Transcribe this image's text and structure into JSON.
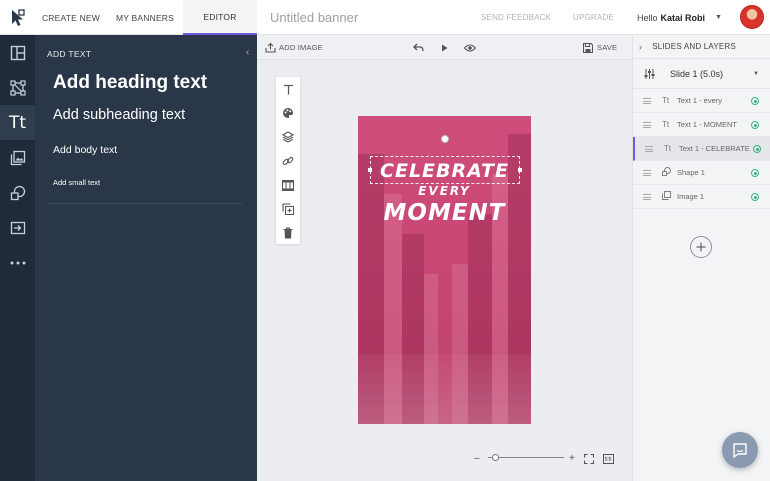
{
  "nav": {
    "tabs": [
      {
        "label": "CREATE NEW"
      },
      {
        "label": "MY BANNERS"
      },
      {
        "label": "EDITOR"
      }
    ],
    "banner_title": "Untitled banner",
    "send_feedback": "SEND FEEDBACK",
    "upgrade": "UPGRADE",
    "hello": "Hello",
    "user_name": "Katai Robi"
  },
  "left_panel": {
    "title": "ADD TEXT",
    "heading": "Add heading text",
    "subheading": "Add subheading text",
    "body": "Add body text",
    "small": "Add small text"
  },
  "rail": {
    "active_label": "Tt"
  },
  "canvas_toolbar": {
    "add_image": "ADD IMAGE",
    "save": "SAVE"
  },
  "banner": {
    "line1": "CELEBRATE",
    "line2": "EVERY",
    "line3": "MOMENT",
    "background_color": "#c94774"
  },
  "right_panel": {
    "title": "SLIDES AND LAYERS",
    "slide": "Slide 1 (5.0s)",
    "layers": [
      {
        "type": "Tt",
        "name": "Text 1 - every"
      },
      {
        "type": "Tt",
        "name": "Text 1 - MOMENT"
      },
      {
        "type": "Tt",
        "name": "Text 1 - CELEBRATE"
      },
      {
        "type": "shape",
        "name": "Shape 1"
      },
      {
        "type": "image",
        "name": "Image 1"
      }
    ]
  },
  "zoom": {
    "minus": "–",
    "plus": "+",
    "level": 0.1
  },
  "colors": {
    "accent": "#6f5bd6",
    "rail_bg": "#1f2b3a",
    "panel_bg": "#2a3748",
    "visible_dot": "#36b37e"
  }
}
